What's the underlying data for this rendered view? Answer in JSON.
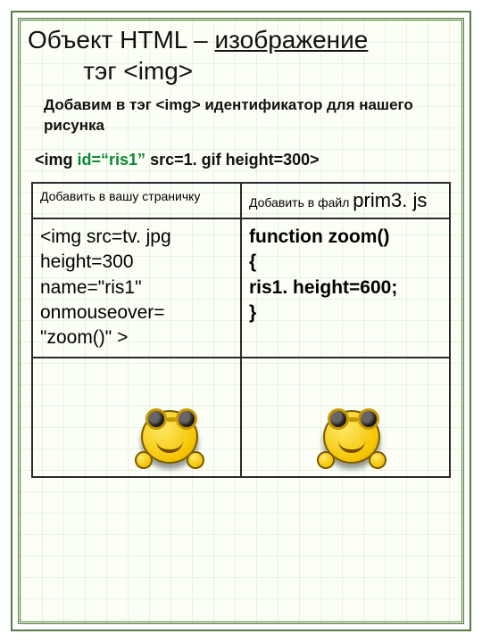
{
  "title_plain": "Объект HTML – ",
  "title_underlined": "изображение",
  "title_line2": "тэг <img>",
  "intro": "Добавим в тэг <img> идентификатор для нашего рисунка",
  "code": {
    "open": "<img ",
    "id_kw": "id",
    "eq": "=",
    "id_val": "“ris1”",
    "rest": " src=1. gif height=300>"
  },
  "table": {
    "left_header_prefix": "Добавить ",
    "left_header_main": "в вашу страничку",
    "right_header_prefix": "Добавить в файл ",
    "right_header_main": "prim3. js",
    "left_body": "<img src=tv. jpg\nheight=300\nname=\"ris1\"\nonmouseover=\n\"zoom()\" >",
    "right_fn": "function zoom()",
    "right_open": "{",
    "right_stmt": "ris1. height=600;",
    "right_close": "}"
  }
}
